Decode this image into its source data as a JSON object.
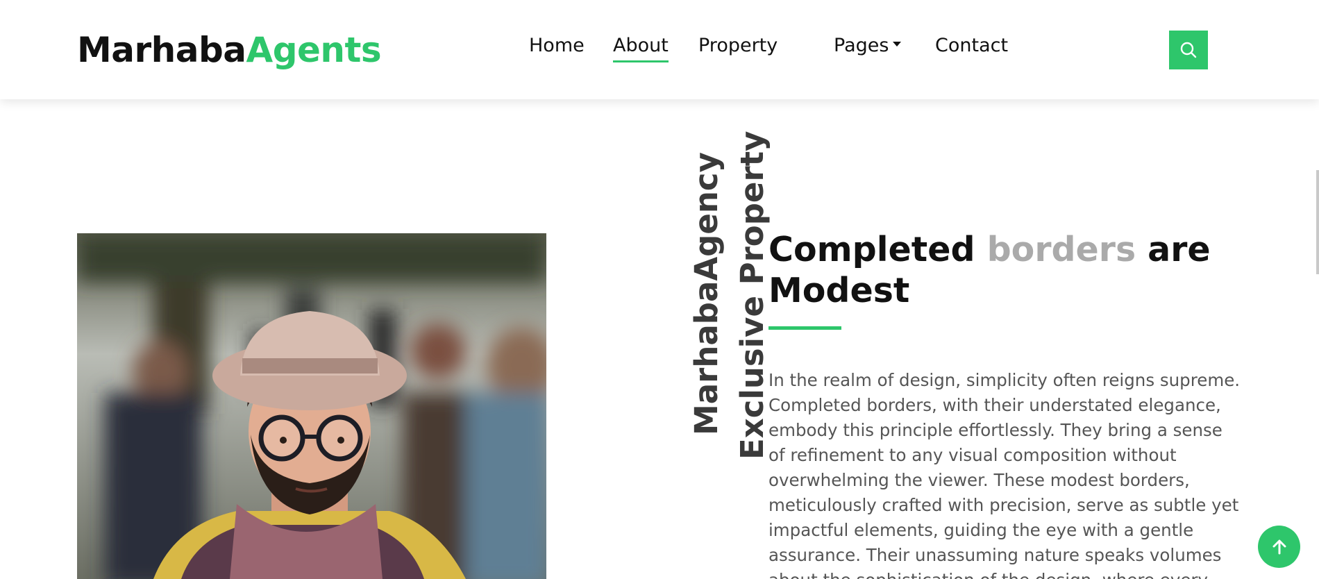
{
  "header": {
    "logo_main": "Marhaba",
    "logo_accent": "Agents",
    "nav": [
      {
        "label": "Home"
      },
      {
        "label": "About"
      },
      {
        "label": "Property"
      },
      {
        "label": "Pages"
      },
      {
        "label": "Contact"
      }
    ],
    "active_nav": "About",
    "search_icon": "search-icon"
  },
  "about": {
    "vertical_label_1": "MarhabaAgency",
    "vertical_label_2": "Exclusive Property",
    "heading_part1": "Completed ",
    "heading_muted": "borders",
    "heading_part2": " are Modest",
    "paragraph": "In the realm of design, simplicity often reigns supreme. Completed borders, with their understated elegance, embody this principle effortlessly. They bring a sense of refinement to any visual composition without overwhelming the viewer. These modest borders, meticulously crafted with precision, serve as subtle yet impactful elements, guiding the eye with a gentle assurance. Their unassuming nature speaks volumes about the sophistication of the design, where every"
  },
  "back_to_top_icon": "arrow-up-icon",
  "colors": {
    "accent": "#2ec66b",
    "heading": "#111111",
    "muted": "#aaaaaa",
    "body_text": "#555555"
  }
}
